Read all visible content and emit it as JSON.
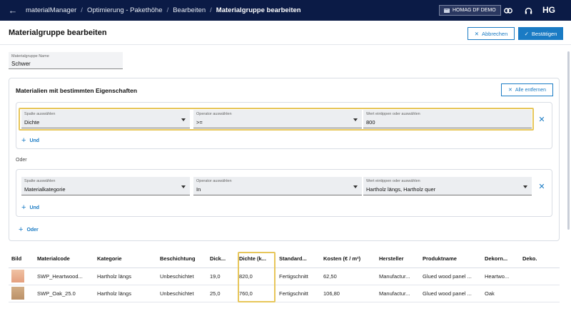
{
  "topbar": {
    "breadcrumb": [
      "materialManager",
      "Optimierung - Pakethöhe",
      "Bearbeiten",
      "Materialgruppe bearbeiten"
    ],
    "demo_label": "HOMAG DF DEMO",
    "logo": "HG"
  },
  "header": {
    "title": "Materialgruppe bearbeiten",
    "cancel_label": "Abbrechen",
    "confirm_label": "Bestätigen"
  },
  "name_field": {
    "label": "Materialgruppe Name",
    "value": "Schwer"
  },
  "filters": {
    "title": "Materialien mit bestimmten Eigenschaften",
    "remove_all_label": "Alle entfernen",
    "or_label": "Oder",
    "and_label": "Und",
    "add_or_label": "Oder",
    "groups": [
      {
        "column": {
          "label": "Spalte auswählen",
          "value": "Dichte"
        },
        "operator": {
          "label": "Operator auswählen",
          "value": ">="
        },
        "value": {
          "label": "Wert eintippen oder auswählen",
          "value": "800"
        }
      },
      {
        "column": {
          "label": "Spalte auswählen",
          "value": "Materialkategorie"
        },
        "operator": {
          "label": "Operator auswählen",
          "value": "In"
        },
        "value": {
          "label": "Wert eintippen oder auswählen",
          "value": "Hartholz längs, Hartholz quer"
        }
      }
    ]
  },
  "table": {
    "headers": [
      "Bild",
      "Materialcode",
      "Kategorie",
      "Beschichtung",
      "Dick...",
      "Dichte (k...",
      "Standard...",
      "Kosten (€ / m²)",
      "Hersteller",
      "Produktname",
      "Dekorn...",
      "Deko."
    ],
    "rows": [
      [
        "",
        "SWP_Heartwood...",
        "Hartholz längs",
        "Unbeschichtet",
        "19,0",
        "820,0",
        "Fertigschnitt",
        "62,50",
        "Manufactur...",
        "Glued wood panel ...",
        "Heartwo...",
        ""
      ],
      [
        "",
        "SWP_Oak_25.0",
        "Hartholz längs",
        "Unbeschichtet",
        "25,0",
        "760,0",
        "Fertigschnitt",
        "106,80",
        "Manufactur...",
        "Glued wood panel ...",
        "Oak",
        ""
      ]
    ],
    "thumb_colors": [
      "#e9b08e",
      "#c8a27a"
    ]
  },
  "colors": {
    "navy": "#0b1b46",
    "accent": "#1a7bc4",
    "highlight": "#e7c65a"
  },
  "icons": [
    "back-arrow-icon",
    "link-icon",
    "headset-icon",
    "close-icon",
    "check-icon",
    "plus-icon"
  ]
}
